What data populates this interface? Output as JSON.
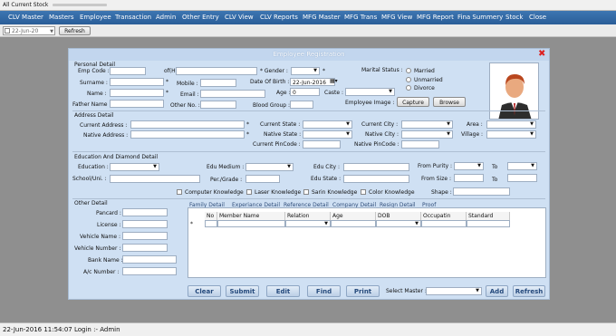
{
  "window_title": "All Current Stock",
  "menu": [
    "CLV Master",
    "Masters",
    "Employee",
    "Transaction",
    "Admin",
    "Other Entry",
    "CLV View",
    "CLV Reports",
    "MFG Master",
    "MFG Trans",
    "MFG View",
    "MFG Report",
    "Fina Summery",
    "Stock",
    "Close"
  ],
  "toolbar": {
    "date": "22-Jun-20",
    "refresh": "Refresh"
  },
  "dialog": {
    "title": "Employee Registration",
    "personal": {
      "section": "Personal Detail",
      "emp_code": "Emp Code :",
      "of": "of(H",
      "surname": "Surname :",
      "name": "Name :",
      "father": "Father Name :",
      "mobile": "Mobile :",
      "email": "Email :",
      "other_no": "Other No. :",
      "gender": "* Gender :",
      "dob": "Date Of Birth :",
      "dob_value": "22-Jun-2016",
      "age": "Age :",
      "age_value": "0",
      "blood": "Blood Group :",
      "caste": "Caste :",
      "marital": "Marital Status :",
      "married": "Married",
      "unmarried": "Unmarried",
      "divorce": "Divorce",
      "emp_image": "Employee Image :",
      "capture": "Capture",
      "browse": "Browse"
    },
    "address": {
      "section": "Address Detail",
      "current_address": "Current Address :",
      "native_address": "Native Address :",
      "current_state": "Current State :",
      "native_state": "Native State :",
      "current_pin": "Current PinCode :",
      "current_city": "Current City :",
      "native_city": "Native City :",
      "native_pin": "Native PinCode :",
      "area": "Area :",
      "village": "Village :"
    },
    "education": {
      "section": "Education And Diamond Detail",
      "education": "Education :",
      "school": "School/Uni. :",
      "edu_medium": "Edu Medium :",
      "per_grade": "Per./Grade :",
      "edu_city": "Edu City :",
      "edu_state": "Edu State :",
      "from_purity": "From Purity :",
      "to": "To",
      "from_size": "From Size :",
      "to2": "To",
      "shape": "Shape :",
      "computer": "Computer Knowledge",
      "laser": "Laser Knowledge",
      "sarin": "Sarin Knowledge",
      "color": "Color Knowledge"
    },
    "other": {
      "section": "Other Detail",
      "pancard": "Pancard :",
      "license": "License :",
      "vehicle_name": "Vehicle Name :",
      "vehicle_number": "Vehicle Number :",
      "bank_name": "Bank Name :",
      "ac_number": "A/c Number :"
    },
    "tabs": [
      "Family Detail",
      "Experiance Detail",
      "Reference Detail",
      "Company Detail",
      "Resign Detail",
      "Proof"
    ],
    "grid_columns": [
      "No",
      "Member Name",
      "Relation",
      "Age",
      "DOB",
      "Occupatin",
      "Standard"
    ],
    "new_row_marker": "*",
    "buttons": {
      "clear": "Clear",
      "submit": "Submit",
      "edit": "Edit",
      "find": "Find",
      "print": "Print",
      "add": "Add",
      "refresh": "Refresh"
    },
    "select_master": "Select Master :"
  },
  "status": "22-Jun-2016   11:54:07  Login :- Admin"
}
